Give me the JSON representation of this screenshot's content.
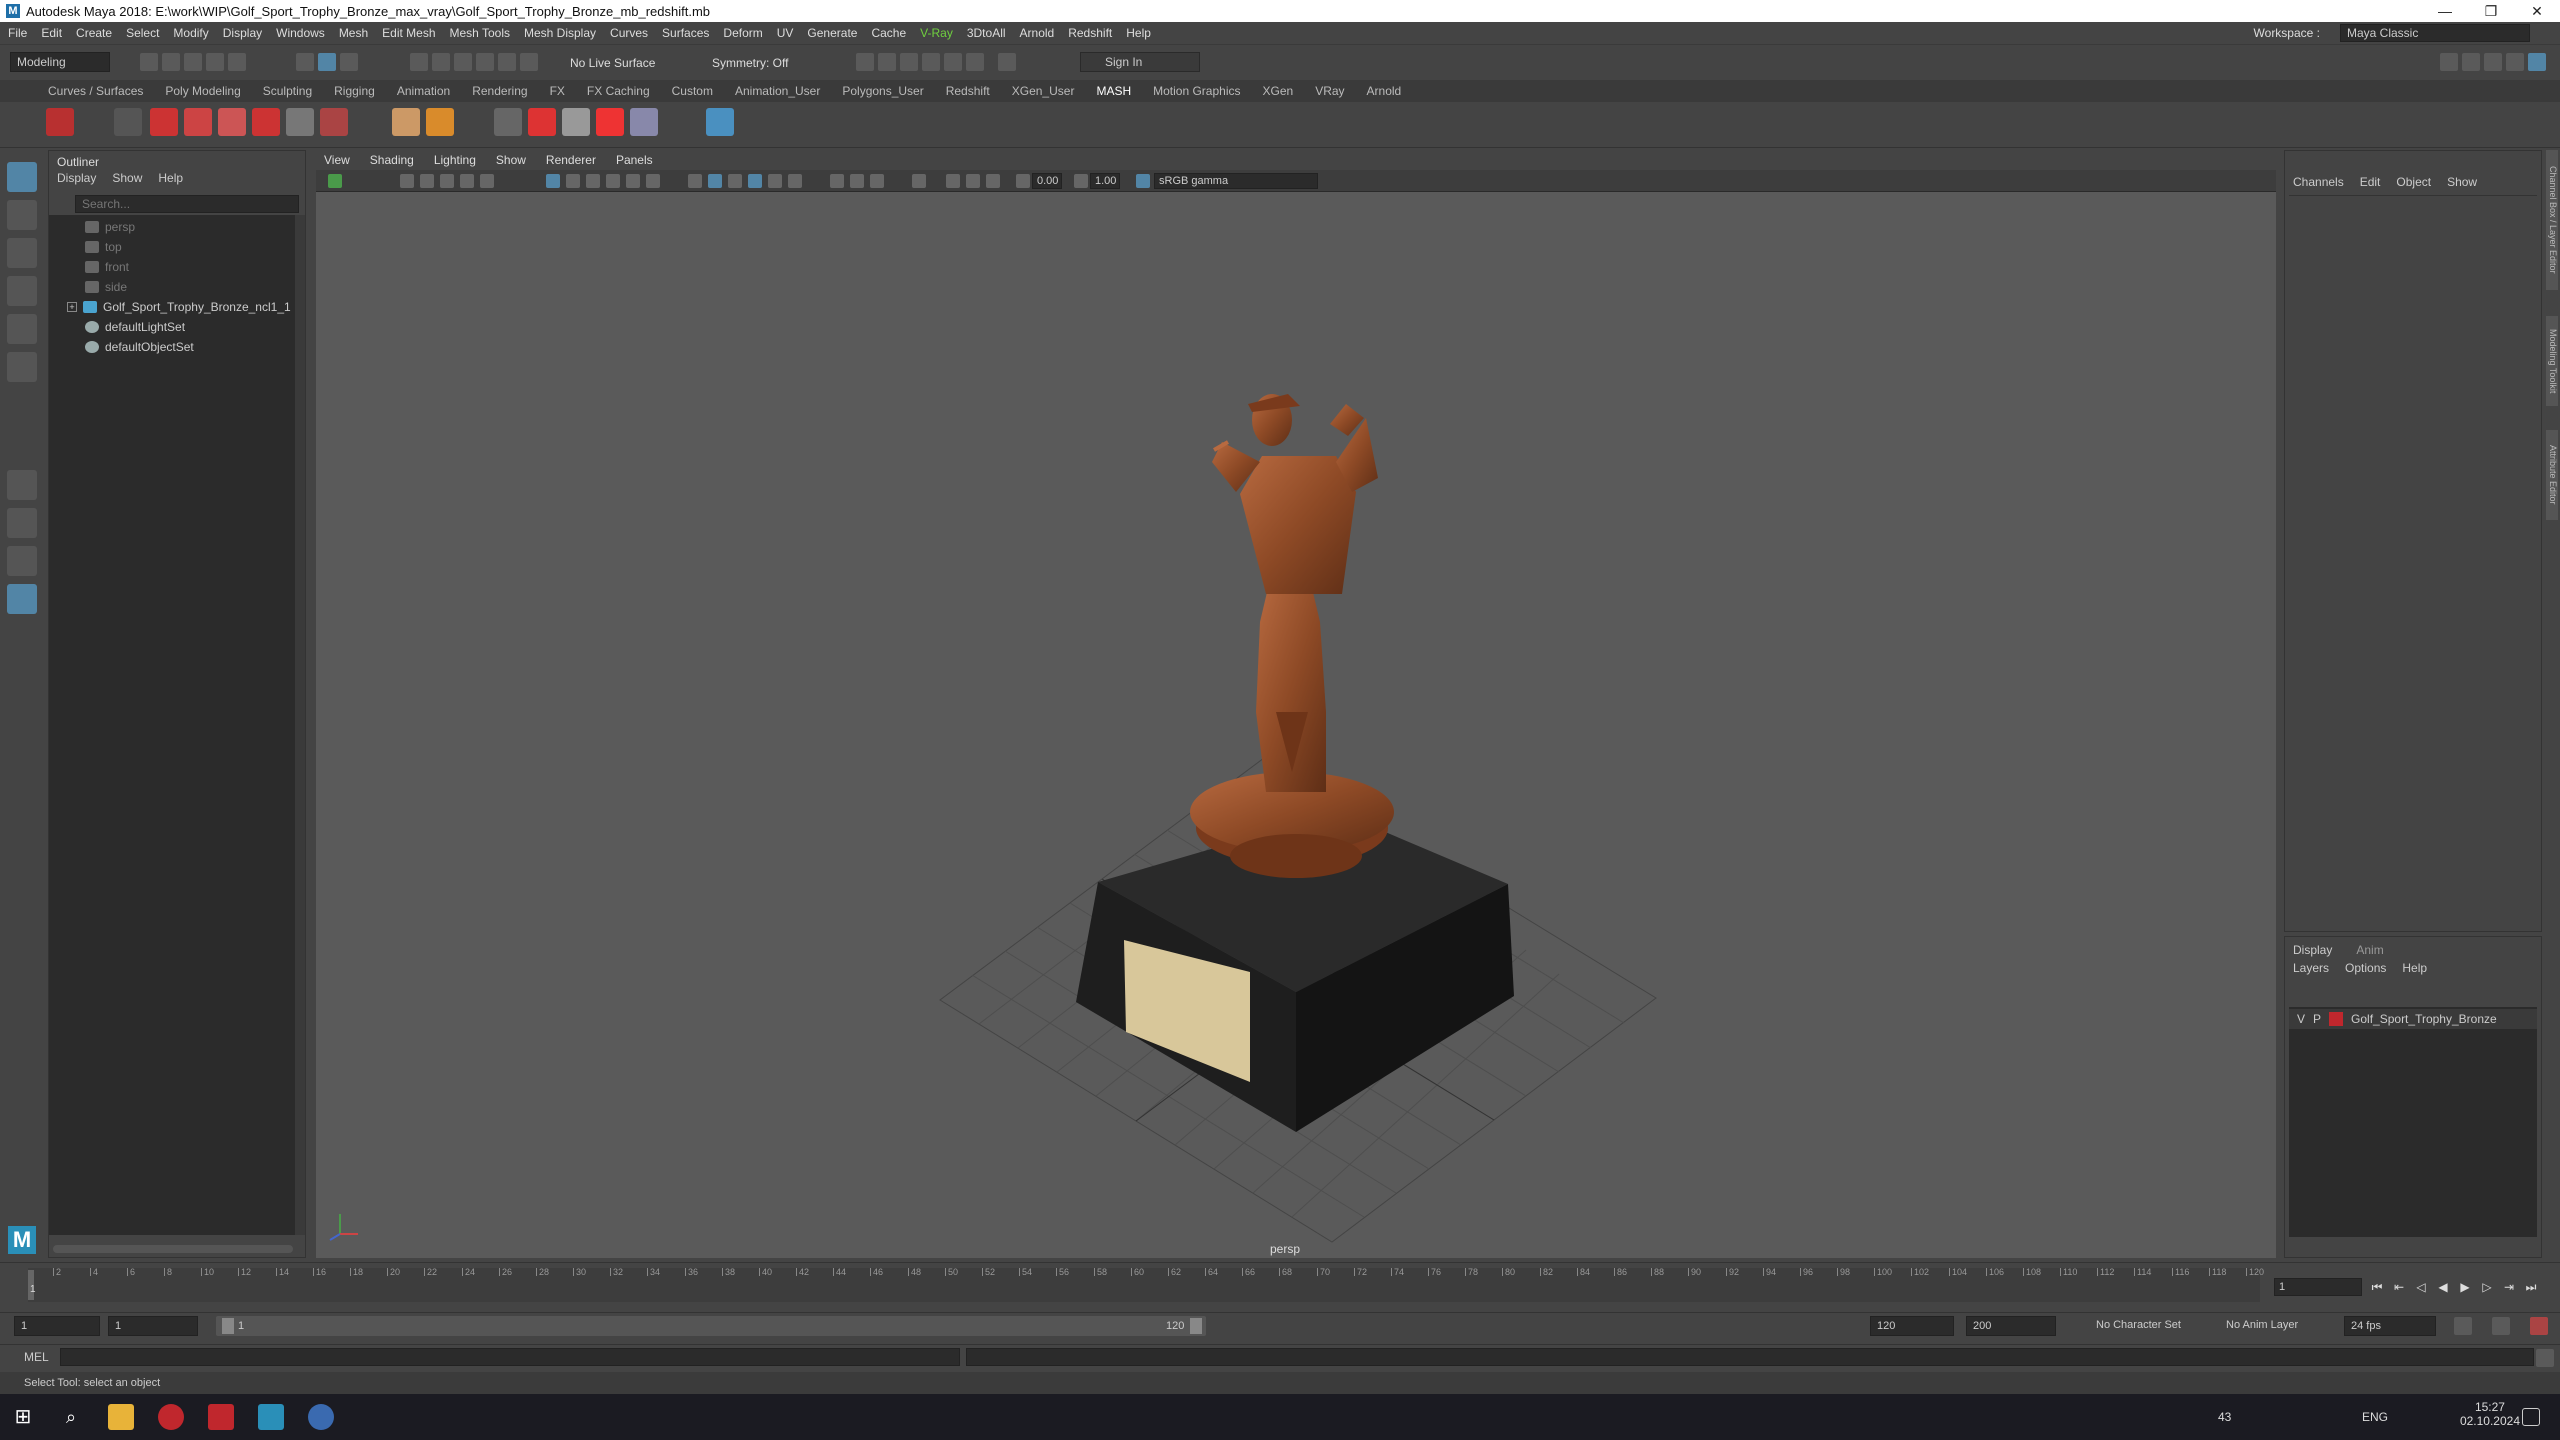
{
  "window": {
    "title": "Autodesk Maya 2018: E:\\work\\WIP\\Golf_Sport_Trophy_Bronze_max_vray\\Golf_Sport_Trophy_Bronze_mb_redshift.mb",
    "minimize": "—",
    "restore": "❐",
    "close": "✕"
  },
  "menu": [
    "File",
    "Edit",
    "Create",
    "Select",
    "Modify",
    "Display",
    "Windows",
    "Mesh",
    "Edit Mesh",
    "Mesh Tools",
    "Mesh Display",
    "Curves",
    "Surfaces",
    "Deform",
    "UV",
    "Generate",
    "Cache",
    "V-Ray",
    "3DtoAll",
    "Arnold",
    "Redshift",
    "Help"
  ],
  "workspace": {
    "label": "Workspace :",
    "value": "Maya Classic"
  },
  "status_line": {
    "mode": "Modeling",
    "live_surface": "No Live Surface",
    "symmetry": "Symmetry: Off",
    "sign_in": "Sign In"
  },
  "shelf_tabs": [
    "Curves / Surfaces",
    "Poly Modeling",
    "Sculpting",
    "Rigging",
    "Animation",
    "Rendering",
    "FX",
    "FX Caching",
    "Custom",
    "Animation_User",
    "Polygons_User",
    "Redshift",
    "XGen_User",
    "MASH",
    "Motion Graphics",
    "XGen",
    "VRay",
    "Arnold"
  ],
  "shelf_active": "MASH",
  "outliner": {
    "title": "Outliner",
    "menus": [
      "Display",
      "Show",
      "Help"
    ],
    "search_placeholder": "Search...",
    "items": [
      {
        "label": "persp",
        "dim": true
      },
      {
        "label": "top",
        "dim": true
      },
      {
        "label": "front",
        "dim": true
      },
      {
        "label": "side",
        "dim": true
      },
      {
        "label": "Golf_Sport_Trophy_Bronze_ncl1_1",
        "dim": false
      },
      {
        "label": "defaultLightSet",
        "dim": false
      },
      {
        "label": "defaultObjectSet",
        "dim": false
      }
    ]
  },
  "viewport": {
    "menus": [
      "View",
      "Shading",
      "Lighting",
      "Show",
      "Renderer",
      "Panels"
    ],
    "exposure": "0.00",
    "gamma": "1.00",
    "color_space": "sRGB gamma",
    "camera": "persp"
  },
  "channel_box": {
    "menus": [
      "Channels",
      "Edit",
      "Object",
      "Show"
    ]
  },
  "side_tabs": [
    "Channel Box / Layer Editor",
    "Modeling Toolkit",
    "Attribute Editor"
  ],
  "layer_editor": {
    "tabs": [
      "Display",
      "Anim"
    ],
    "menus": [
      "Layers",
      "Options",
      "Help"
    ],
    "layer": {
      "v": "V",
      "p": "P",
      "name": "Golf_Sport_Trophy_Bronze",
      "color": "#c0272d"
    }
  },
  "timeline": {
    "ticks": [
      2,
      4,
      6,
      8,
      10,
      12,
      14,
      16,
      18,
      20,
      22,
      24,
      26,
      28,
      30,
      32,
      34,
      36,
      38,
      40,
      42,
      44,
      46,
      48,
      50,
      52,
      54,
      56,
      58,
      60,
      62,
      64,
      66,
      68,
      70,
      72,
      74,
      76,
      78,
      80,
      82,
      84,
      86,
      88,
      90,
      92,
      94,
      96,
      98,
      100,
      102,
      104,
      106,
      108,
      110,
      112,
      114,
      116,
      118,
      120
    ],
    "current_frame": "1",
    "current_label": "1"
  },
  "range": {
    "start": "1",
    "playback_start": "1",
    "slider_start": "1",
    "slider_end": "120",
    "playback_end": "120",
    "end": "200",
    "character_set": "No Character Set",
    "anim_layer": "No Anim Layer",
    "fps": "24 fps"
  },
  "command_line": {
    "label": "MEL"
  },
  "help_line": "Select Tool: select an object",
  "taskbar": {
    "tray_text": "43",
    "language": "ENG",
    "time": "15:27",
    "date": "02.10.2024"
  },
  "colors": {
    "bronze": "#a0522d",
    "plaque": "#d8c79a",
    "base": "#1a1a1a",
    "select_blue": "#5285a6"
  }
}
